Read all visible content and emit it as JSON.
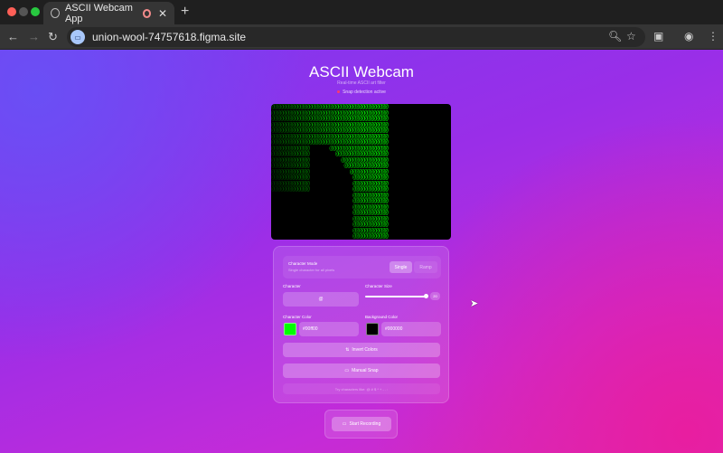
{
  "browser": {
    "tab_title": "ASCII Webcam App",
    "url": "union-wool-74757618.figma.site"
  },
  "header": {
    "title": "ASCII Webcam",
    "subtitle": "Real-time ASCII art filter",
    "status": "Snap detection active"
  },
  "video": {
    "character": "@",
    "color": "#00ff00"
  },
  "controls": {
    "mode_label": "Character Mode",
    "mode_desc": "Single character for all pixels",
    "mode_options": [
      "Single",
      "Ramp"
    ],
    "mode_selected": "Single",
    "character_label": "Character",
    "character_value": "@",
    "size_label": "Character Size",
    "size_value": "20",
    "char_color_label": "Character Color",
    "char_color_value": "#00ff00",
    "bg_color_label": "Background Color",
    "bg_color_value": "#000000",
    "invert_label": "Invert Colors",
    "snap_label": "Manual Snap",
    "tip": "Try characters like: @ # $ * + - . :"
  },
  "record_label": "Start Recording"
}
